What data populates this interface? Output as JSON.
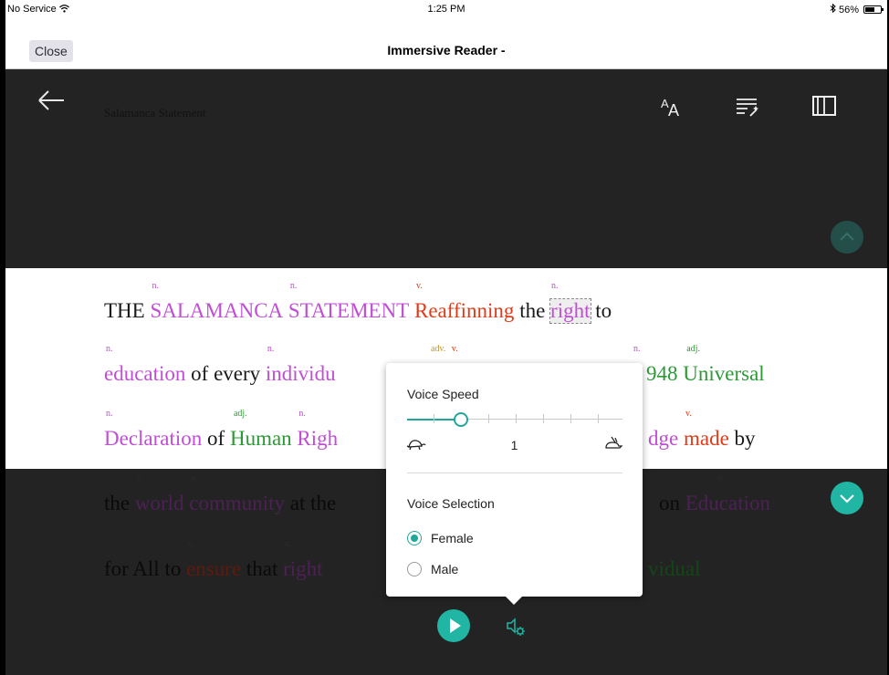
{
  "status_bar": {
    "carrier": "No Service",
    "time": "1:25 PM",
    "battery": "56%",
    "battery_level": 0.56,
    "wifi_icon": "wifi-icon",
    "bluetooth_icon": "bluetooth-icon"
  },
  "nav": {
    "close_label": "Close",
    "title": "Immersive Reader -"
  },
  "reader": {
    "doc_title": "Salamanca Statement",
    "icons": [
      "back-arrow-icon",
      "text-size-icon",
      "grammar-options-icon",
      "reading-preferences-icon",
      "chevron-up-icon"
    ]
  },
  "text_lines": [
    {
      "words": [
        {
          "text": "THE",
          "pos": "",
          "cls": "black"
        },
        {
          "text": "SALAMANCA",
          "pos": "n.",
          "cls": "noun"
        },
        {
          "text": "STATEMENT",
          "pos": "n.",
          "cls": "noun"
        },
        {
          "text": "Reaffinning",
          "pos": "v.",
          "cls": "verb"
        },
        {
          "text": "the",
          "pos": "",
          "cls": "black"
        },
        {
          "text": "right",
          "pos": "n.",
          "cls": "noun",
          "highlight": true
        },
        {
          "text": "to",
          "pos": "",
          "cls": "black"
        }
      ]
    },
    {
      "words": [
        {
          "text": "education",
          "pos": "n.",
          "cls": "noun"
        },
        {
          "text": "of every",
          "pos": "",
          "cls": "black"
        },
        {
          "text": "individu",
          "pos": "n.",
          "cls": "noun"
        }
      ],
      "tail": [
        {
          "text": "948",
          "pos": "n.",
          "cls": "adj"
        },
        {
          "text": "Universal",
          "pos": "adj.",
          "cls": "adj"
        }
      ],
      "hidden_tags": [
        "adv.",
        "v."
      ]
    },
    {
      "words": [
        {
          "text": "Declaration",
          "pos": "n.",
          "cls": "noun"
        },
        {
          "text": "of",
          "pos": "",
          "cls": "black"
        },
        {
          "text": "Human",
          "pos": "adj.",
          "cls": "adj"
        },
        {
          "text": "Righ",
          "pos": "n.",
          "cls": "noun"
        }
      ],
      "tail": [
        {
          "text": "dge",
          "pos": "",
          "cls": "noun"
        },
        {
          "text": "made",
          "pos": "v.",
          "cls": "verb"
        },
        {
          "text": "by",
          "pos": "",
          "cls": "black"
        }
      ]
    },
    {
      "words": [
        {
          "text": "the",
          "pos": "",
          "cls": "black"
        },
        {
          "text": "world",
          "pos": "n.",
          "cls": "noun"
        },
        {
          "text": "community",
          "pos": "n.",
          "cls": "noun"
        },
        {
          "text": "at the",
          "pos": "",
          "cls": "black"
        }
      ],
      "tail": [
        {
          "text": "on",
          "pos": "",
          "cls": "black"
        },
        {
          "text": "Education",
          "pos": "n.",
          "cls": "noun"
        }
      ]
    },
    {
      "words": [
        {
          "text": "for All to",
          "pos": "",
          "cls": "black"
        },
        {
          "text": "ensure",
          "pos": "v.",
          "cls": "verb"
        },
        {
          "text": "that",
          "pos": "",
          "cls": "black"
        },
        {
          "text": "right",
          "pos": "n.",
          "cls": "noun"
        }
      ],
      "tail": [
        {
          "text": "vidual",
          "pos": "",
          "cls": "adj"
        }
      ]
    }
  ],
  "voice_panel": {
    "speed_heading": "Voice Speed",
    "speed_value": "1",
    "speed_fraction": 0.25,
    "selection_heading": "Voice Selection",
    "options": [
      {
        "label": "Female",
        "selected": true
      },
      {
        "label": "Male",
        "selected": false
      }
    ],
    "slow_icon": "turtle-icon",
    "fast_icon": "rabbit-icon"
  },
  "controls": {
    "play_icon": "play-icon",
    "voice_settings_icon": "voice-settings-icon",
    "accent": "#21b6a4"
  }
}
